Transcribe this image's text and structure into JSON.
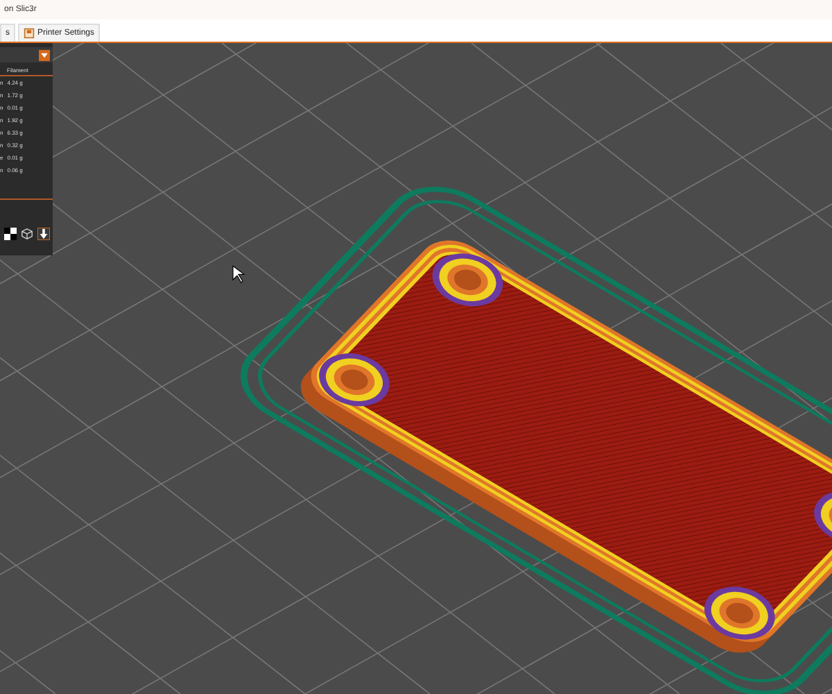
{
  "window": {
    "title": "on Slic3r"
  },
  "tabs": [
    {
      "label": "s",
      "selected": false
    },
    {
      "label": "Printer Settings",
      "selected": false
    }
  ],
  "panel": {
    "header": "Filament",
    "rows": [
      {
        "label": "n",
        "value": "4.24 g"
      },
      {
        "label": "n",
        "value": "1.72 g"
      },
      {
        "label": "n",
        "value": "0.01 g"
      },
      {
        "label": "n",
        "value": "1.92 g"
      },
      {
        "label": "n",
        "value": "6.33 g"
      },
      {
        "label": "n",
        "value": "0.32 g"
      },
      {
        "label": "e",
        "value": "0.01 g"
      },
      {
        "label": "n",
        "value": "0.06 g"
      }
    ]
  }
}
